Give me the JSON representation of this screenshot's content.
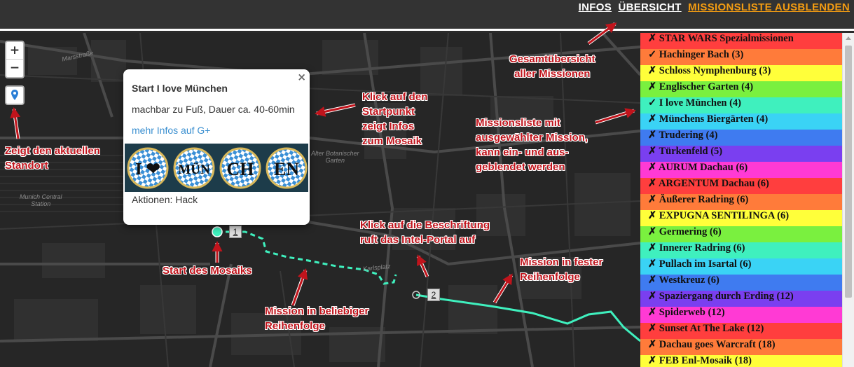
{
  "topnav": {
    "infos": "INFOS",
    "overview": "ÜBERSICHT",
    "hide_list": "MISSIONSLISTE AUSBLENDEN"
  },
  "map": {
    "zoom_in": "+",
    "zoom_out": "−",
    "street_labels": [
      "Marsstraße",
      "Alter Botanischer\nGarten",
      "Munich Central\nStation",
      "Karlsplatz"
    ],
    "waypoints": [
      "1",
      "2"
    ]
  },
  "popup": {
    "close": "×",
    "title": "Start I love München",
    "description": "machbar zu Fuß, Dauer ca. 40-60min",
    "link": "mehr Infos auf G+",
    "banner_tiles": [
      "I ❤",
      "MÜN",
      "CH",
      "EN"
    ],
    "actions": "Aktionen: Hack"
  },
  "missions": [
    {
      "label": "✗ STAR WARS Spezialmissionen",
      "color": "#ff3e3e"
    },
    {
      "label": "✓ Hachinger Bach (3)",
      "color": "#ff7b3a"
    },
    {
      "label": "✗ Schloss Nymphenburg (3)",
      "color": "#ffff3a"
    },
    {
      "label": "✗ Englischer Garten (4)",
      "color": "#7af03f"
    },
    {
      "label": "✓ I love München (4)",
      "color": "#3ff0be"
    },
    {
      "label": "✗ Münchens Biergärten (4)",
      "color": "#3ad3f5"
    },
    {
      "label": "✗ Trudering (4)",
      "color": "#3f7bf0"
    },
    {
      "label": "✗ Türkenfeld (5)",
      "color": "#7a3ff0"
    },
    {
      "label": "✗ AURUM Dachau (6)",
      "color": "#ff3ad4"
    },
    {
      "label": "✗ ARGENTUM Dachau (6)",
      "color": "#ff3e3e"
    },
    {
      "label": "✗ Äußerer Radring (6)",
      "color": "#ff7b3a"
    },
    {
      "label": "✗ EXPUGNA SENTILINGA (6)",
      "color": "#ffff3a"
    },
    {
      "label": "✗ Germering (6)",
      "color": "#7af03f"
    },
    {
      "label": "✗ Innerer Radring (6)",
      "color": "#3ff0be"
    },
    {
      "label": "✗ Pullach im Isartal (6)",
      "color": "#3ad3f5"
    },
    {
      "label": "✗ Westkreuz (6)",
      "color": "#3f7bf0"
    },
    {
      "label": "✗ Spaziergang durch Erding (12)",
      "color": "#7a3ff0"
    },
    {
      "label": "✗ Spiderweb (12)",
      "color": "#ff3ad4"
    },
    {
      "label": "✗ Sunset At The Lake (12)",
      "color": "#ff3e3e"
    },
    {
      "label": "✗ Dachau goes Warcraft (18)",
      "color": "#ff7b3a"
    },
    {
      "label": "✗ FEB Enl-Mosaik (18)",
      "color": "#ffff3a"
    }
  ],
  "annotations": {
    "overview": "Gesamtübersicht\naller Missionen",
    "start_click": "Klick auf den\nStartpunkt\nzeigt Infos\nzum Mosaik",
    "mission_list": "Missionsliste mit\nausgewählter Mission,\nkann ein- und aus-\ngeblendet werden",
    "location": "Zeigt den aktuellen\nStandort",
    "label_click": "Klick auf die Beschriftung\nruft das Intel-Portal auf",
    "fixed_order": "Mission in fester\nReihenfolge",
    "start": "Start des Mosaiks",
    "any_order": "Mission in beliebiger\nReihenfolge"
  },
  "colors": {
    "route": "#3ff0be",
    "annotation": "#c0141c",
    "nav_accent": "#f39c12"
  }
}
